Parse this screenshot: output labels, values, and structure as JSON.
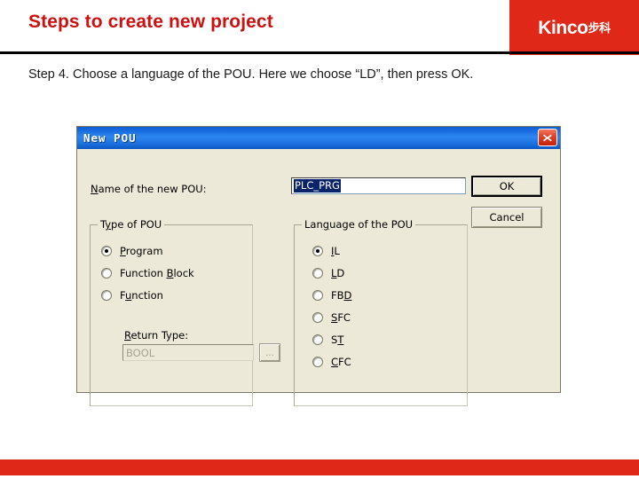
{
  "slide": {
    "title": "Steps to create new project",
    "logo_text": "Kinco",
    "logo_text_cn": "步科",
    "accent_red": "#e02818",
    "title_red": "#cc1111",
    "step_text": "Step 4. Choose a language of the POU. Here we choose “LD”, then press OK."
  },
  "dialog": {
    "title": "New POU",
    "close_icon": "close-x-icon",
    "name_label": "Name of the new POU:",
    "name_value": "PLC_PRG",
    "buttons": {
      "ok": "OK",
      "cancel": "Cancel"
    },
    "type_group": {
      "title": "Type of POU",
      "options": [
        {
          "label": "Program",
          "checked": true
        },
        {
          "label": "Function Block",
          "checked": false
        },
        {
          "label": "Function",
          "checked": false
        }
      ],
      "return_label": "Return Type:",
      "return_value": "BOOL",
      "browse_label": "..."
    },
    "language_group": {
      "title": "Language of the POU",
      "options": [
        {
          "label": "IL",
          "checked": true
        },
        {
          "label": "LD",
          "checked": false
        },
        {
          "label": "FBD",
          "checked": false
        },
        {
          "label": "SFC",
          "checked": false
        },
        {
          "label": "ST",
          "checked": false
        },
        {
          "label": "CFC",
          "checked": false
        }
      ]
    }
  }
}
